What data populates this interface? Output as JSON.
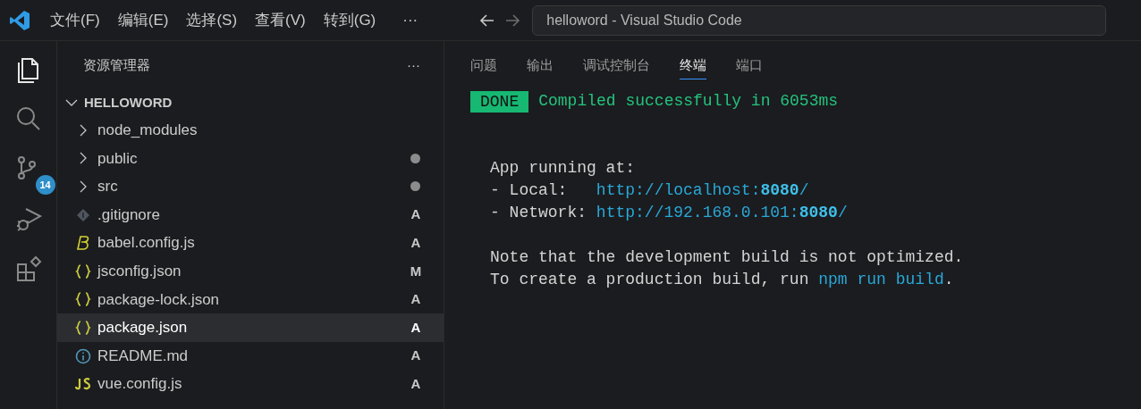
{
  "menu": [
    "文件(F)",
    "编辑(E)",
    "选择(S)",
    "查看(V)",
    "转到(G)",
    "···"
  ],
  "window": {
    "title": "helloword - Visual Studio Code"
  },
  "activity_bar": [
    {
      "kind": "explorer",
      "selected": true
    },
    {
      "kind": "search",
      "selected": false
    },
    {
      "kind": "source-control",
      "selected": false,
      "badge": "14"
    },
    {
      "kind": "run-debug",
      "selected": false
    },
    {
      "kind": "extensions",
      "selected": false
    }
  ],
  "sidebar": {
    "title": "资源管理器",
    "more": "···",
    "root": {
      "label": "HELLOWORD",
      "expanded": true,
      "children": [
        {
          "label": "node_modules",
          "kind": "folder",
          "expanded": false,
          "modified": false,
          "selected": false
        },
        {
          "label": "public",
          "kind": "folder",
          "expanded": false,
          "modified": true,
          "selected": false
        },
        {
          "label": "src",
          "kind": "folder",
          "expanded": false,
          "modified": true,
          "selected": false
        },
        {
          "label": ".gitignore",
          "kind": "git-file",
          "status": "A",
          "selected": false
        },
        {
          "label": "babel.config.js",
          "kind": "babel-file",
          "status": "A",
          "selected": false
        },
        {
          "label": "jsconfig.json",
          "kind": "json-file",
          "status": "M",
          "selected": false
        },
        {
          "label": "package-lock.json",
          "kind": "json-file",
          "status": "A",
          "selected": false
        },
        {
          "label": "package.json",
          "kind": "json-file",
          "status": "A",
          "selected": true
        },
        {
          "label": "README.md",
          "kind": "info-file",
          "status": "A",
          "selected": false
        },
        {
          "label": "vue.config.js",
          "kind": "js-file",
          "status": "A",
          "selected": false
        }
      ]
    }
  },
  "panel": {
    "tabs": [
      {
        "label": "问题",
        "selected": false
      },
      {
        "label": "输出",
        "selected": false
      },
      {
        "label": "调试控制台",
        "selected": false
      },
      {
        "label": "终端",
        "selected": true
      },
      {
        "label": "端口",
        "selected": false
      }
    ],
    "terminal": [
      [
        [
          {
            "kind": "badge",
            "text": "DONE"
          },
          {
            "kind": "success",
            "text": "Compiled successfully in 6053ms"
          }
        ]
      ],
      [
        [
          {
            "kind": "plain",
            "text": "App running at:"
          }
        ],
        [
          {
            "kind": "plain",
            "text": "- Local:   "
          },
          {
            "kind": "link",
            "text": "http://localhost:**8080**/"
          }
        ],
        [
          {
            "kind": "plain",
            "text": "- Network: "
          },
          {
            "kind": "link",
            "text": "http://192.168.0.101:**8080**/"
          }
        ]
      ],
      [
        [
          {
            "kind": "plain",
            "text": "Note that the development build is not optimized."
          }
        ],
        [
          {
            "kind": "plain",
            "text": "To create a production build, run "
          },
          {
            "kind": "link",
            "text": "npm run build"
          },
          {
            "kind": "plain",
            "text": "."
          }
        ]
      ]
    ]
  }
}
